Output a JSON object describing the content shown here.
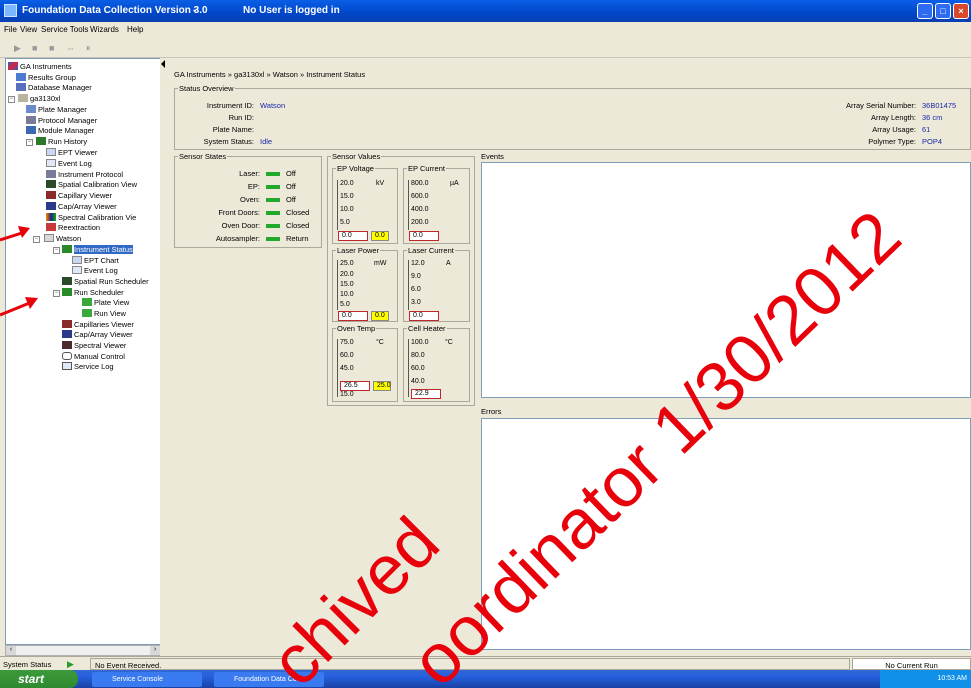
{
  "window": {
    "title": "Foundation Data Collection Version 3.0",
    "separator": "-",
    "user_status": "No User is logged in"
  },
  "menu": [
    "File",
    "View",
    "Service Tools",
    "Wizards",
    "Help"
  ],
  "tree": {
    "items": [
      {
        "label": "GA Instruments",
        "icon": "ga-instruments-icon"
      },
      {
        "label": "Results Group",
        "icon": "results-group-icon"
      },
      {
        "label": "Database Manager",
        "icon": "database-icon"
      },
      {
        "label": "ga3130xl",
        "icon": "instrument-icon"
      },
      {
        "label": "Plate Manager",
        "icon": "plate-icon"
      },
      {
        "label": "Protocol Manager",
        "icon": "protocol-icon"
      },
      {
        "label": "Module Manager",
        "icon": "module-icon"
      },
      {
        "label": "Run History",
        "icon": "run-history-icon"
      },
      {
        "label": "EPT Viewer",
        "icon": "chart-icon"
      },
      {
        "label": "Event Log",
        "icon": "log-icon"
      },
      {
        "label": "Instrument Protocol",
        "icon": "protocol-icon"
      },
      {
        "label": "Spatial Calibration View",
        "icon": "spatial-icon"
      },
      {
        "label": "Capillary Viewer",
        "icon": "capillary-icon"
      },
      {
        "label": "Cap/Array Viewer",
        "icon": "array-icon"
      },
      {
        "label": "Spectral Calibration Vie",
        "icon": "spectral-icon"
      },
      {
        "label": "Reextraction",
        "icon": "reextraction-icon"
      },
      {
        "label": "Watson",
        "icon": "folder-icon"
      },
      {
        "label": "Instrument Status",
        "icon": "status-icon"
      },
      {
        "label": "EPT Chart",
        "icon": "chart-icon"
      },
      {
        "label": "Event Log",
        "icon": "log-icon"
      },
      {
        "label": "Spatial Run Scheduler",
        "icon": "spatial-icon"
      },
      {
        "label": "Run Scheduler",
        "icon": "scheduler-icon"
      },
      {
        "label": "Plate View",
        "icon": "plate-icon"
      },
      {
        "label": "Run View",
        "icon": "run-icon"
      },
      {
        "label": "Capillaries Viewer",
        "icon": "capillary-icon"
      },
      {
        "label": "Cap/Array Viewer",
        "icon": "array-icon"
      },
      {
        "label": "Spectral Viewer",
        "icon": "spectral-icon"
      },
      {
        "label": "Manual Control",
        "icon": "hand-icon"
      },
      {
        "label": "Service Log",
        "icon": "log-icon"
      }
    ]
  },
  "breadcrumb": "GA Instruments » ga3130xl » Watson » Instrument Status",
  "status_overview": {
    "legend": "Status Overview",
    "instrument_id_label": "Instrument ID:",
    "instrument_id": "Watson",
    "run_id_label": "Run ID:",
    "run_id": "",
    "plate_name_label": "Plate Name:",
    "plate_name": "",
    "system_status_label": "System Status:",
    "system_status": "Idle",
    "array_serial_label": "Array Serial Number:",
    "array_serial": "36B01475",
    "array_length_label": "Array Length:",
    "array_length": "36 cm",
    "array_usage_label": "Array Usage:",
    "array_usage": "61",
    "polymer_type_label": "Polymer Type:",
    "polymer_type": "POP4"
  },
  "sensor_states": {
    "legend": "Sensor States",
    "rows": [
      {
        "label": "Laser:",
        "value": "Off"
      },
      {
        "label": "EP:",
        "value": "Off"
      },
      {
        "label": "Oven:",
        "value": "Off"
      },
      {
        "label": "Front Doors:",
        "value": "Closed"
      },
      {
        "label": "Oven Door:",
        "value": "Closed"
      },
      {
        "label": "Autosampler:",
        "value": "Return"
      }
    ],
    "led_color": "#22a82b"
  },
  "sensor_values": {
    "legend": "Sensor Values",
    "ep_voltage": {
      "title": "EP Voltage",
      "unit": "kV",
      "ticks": [
        "20.0",
        "15.0",
        "10.0",
        "5.0"
      ],
      "actual": "0.0",
      "setpoint": "0.0"
    },
    "ep_current": {
      "title": "EP Current",
      "unit": "µA",
      "ticks": [
        "800.0",
        "600.0",
        "400.0",
        "200.0"
      ],
      "actual": "0.0"
    },
    "laser_power": {
      "title": "Laser Power",
      "unit": "mW",
      "ticks": [
        "25.0",
        "20.0",
        "15.0",
        "10.0",
        "5.0"
      ],
      "actual": "0.0",
      "setpoint": "0.0"
    },
    "laser_current": {
      "title": "Laser Current",
      "unit": "A",
      "ticks": [
        "12.0",
        "9.0",
        "6.0",
        "3.0"
      ],
      "actual": "0.0"
    },
    "oven_temp": {
      "title": "Oven Temp",
      "unit": "°C",
      "ticks": [
        "75.0",
        "60.0",
        "45.0",
        "15.0"
      ],
      "actual": "26.5",
      "setpoint": "25.0"
    },
    "cell_heater": {
      "title": "Cell Heater",
      "unit": "°C",
      "ticks": [
        "100.0",
        "80.0",
        "60.0",
        "40.0"
      ],
      "actual": "22.9"
    }
  },
  "events": {
    "legend": "Events"
  },
  "errors": {
    "legend": "Errors"
  },
  "status_bar": {
    "label": "System Status",
    "message": "No Event Received.",
    "run_status": "No Current Run"
  },
  "taskbar": {
    "start": "start",
    "tasks": [
      "Service Console",
      "Foundation Data Col..."
    ],
    "clock": "10:53 AM"
  },
  "watermark": {
    "text1": "chived",
    "text2": "oordinator 1/30/2012",
    "color": "#e8000a"
  },
  "colors": {
    "title_bar": "#0046c8",
    "value_text": "#1a28a8",
    "setpoint_bg": "#ffff00",
    "selection": "#316ac5"
  }
}
